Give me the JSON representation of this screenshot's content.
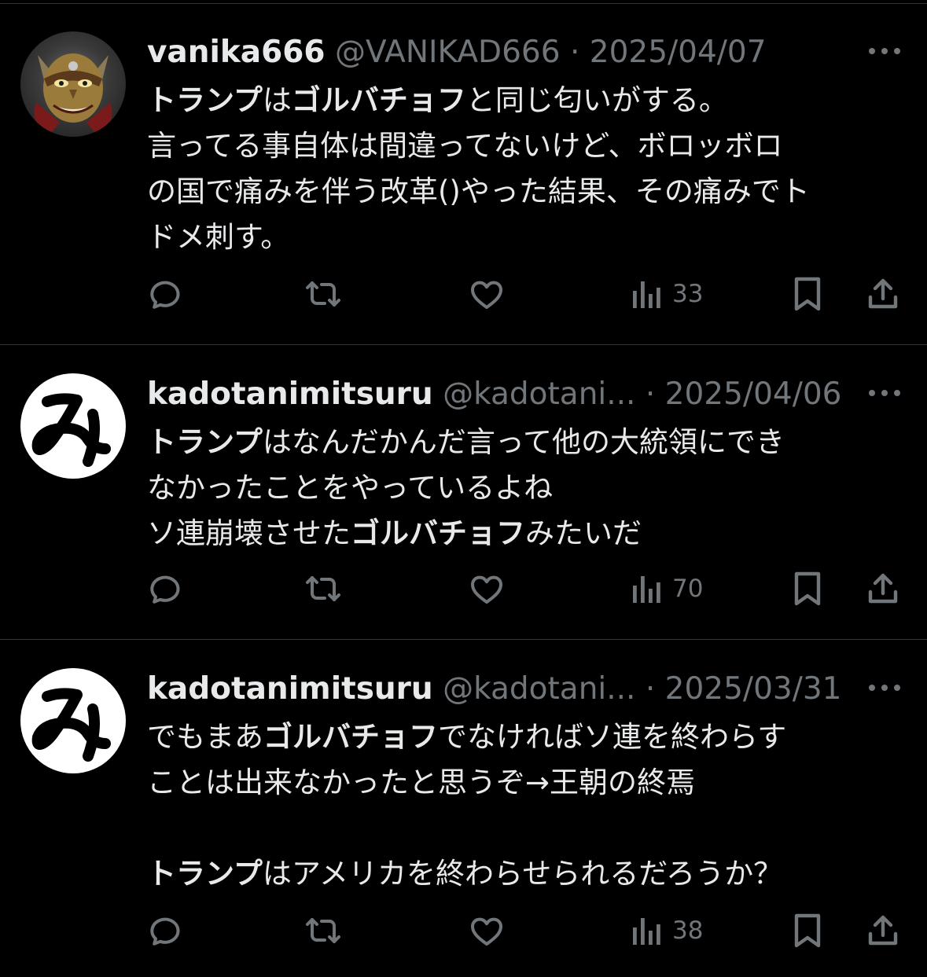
{
  "colors": {
    "background": "#000000",
    "primary_text": "#e7e9ea",
    "secondary_text": "#71767b",
    "divider": "#2f3336"
  },
  "tweets": [
    {
      "display_name": "vanika666",
      "handle": "@VANIKAD666",
      "separator": "·",
      "date": "2025/04/07",
      "avatar_icon": "demon-mask-avatar",
      "lines": [
        [
          {
            "t": "トランプ",
            "b": true
          },
          {
            "t": "は",
            "b": false
          },
          {
            "t": "ゴルバチョフ",
            "b": true
          },
          {
            "t": "と同じ匂いがする。",
            "b": false
          }
        ],
        [
          {
            "t": "言ってる事自体は間違ってないけど、ボロッボロ",
            "b": false
          }
        ],
        [
          {
            "t": "の国で痛みを伴う改革()やった結果、その痛みでト",
            "b": false
          }
        ],
        [
          {
            "t": "ドメ刺す。",
            "b": false
          }
        ]
      ],
      "views": "33"
    },
    {
      "display_name": "kadotanimitsuru",
      "handle": "@kadotani...",
      "separator": "·",
      "date": "2025/04/06",
      "avatar_icon": "hiragana-mi-avatar",
      "lines": [
        [
          {
            "t": "トランプ",
            "b": true
          },
          {
            "t": "はなんだかんだ言って他の大統領にでき",
            "b": false
          }
        ],
        [
          {
            "t": "なかったことをやっているよね",
            "b": false
          }
        ],
        [
          {
            "t": "ソ連崩壊させた",
            "b": false
          },
          {
            "t": "ゴルバチョフ",
            "b": true
          },
          {
            "t": "みたいだ",
            "b": false
          }
        ]
      ],
      "views": "70"
    },
    {
      "display_name": "kadotanimitsuru",
      "handle": "@kadotani...",
      "separator": "·",
      "date": "2025/03/31",
      "avatar_icon": "hiragana-mi-avatar",
      "lines": [
        [
          {
            "t": "でもまあ",
            "b": false
          },
          {
            "t": "ゴルバチョフ",
            "b": true
          },
          {
            "t": "でなければソ連を終わらす",
            "b": false
          }
        ],
        [
          {
            "t": "ことは出来なかったと思うぞ→王朝の終焉",
            "b": false
          }
        ],
        [],
        [
          {
            "t": "トランプ",
            "b": true
          },
          {
            "t": "はアメリカを終わらせられるだろうか？",
            "b": false
          }
        ]
      ],
      "views": "38"
    }
  ]
}
